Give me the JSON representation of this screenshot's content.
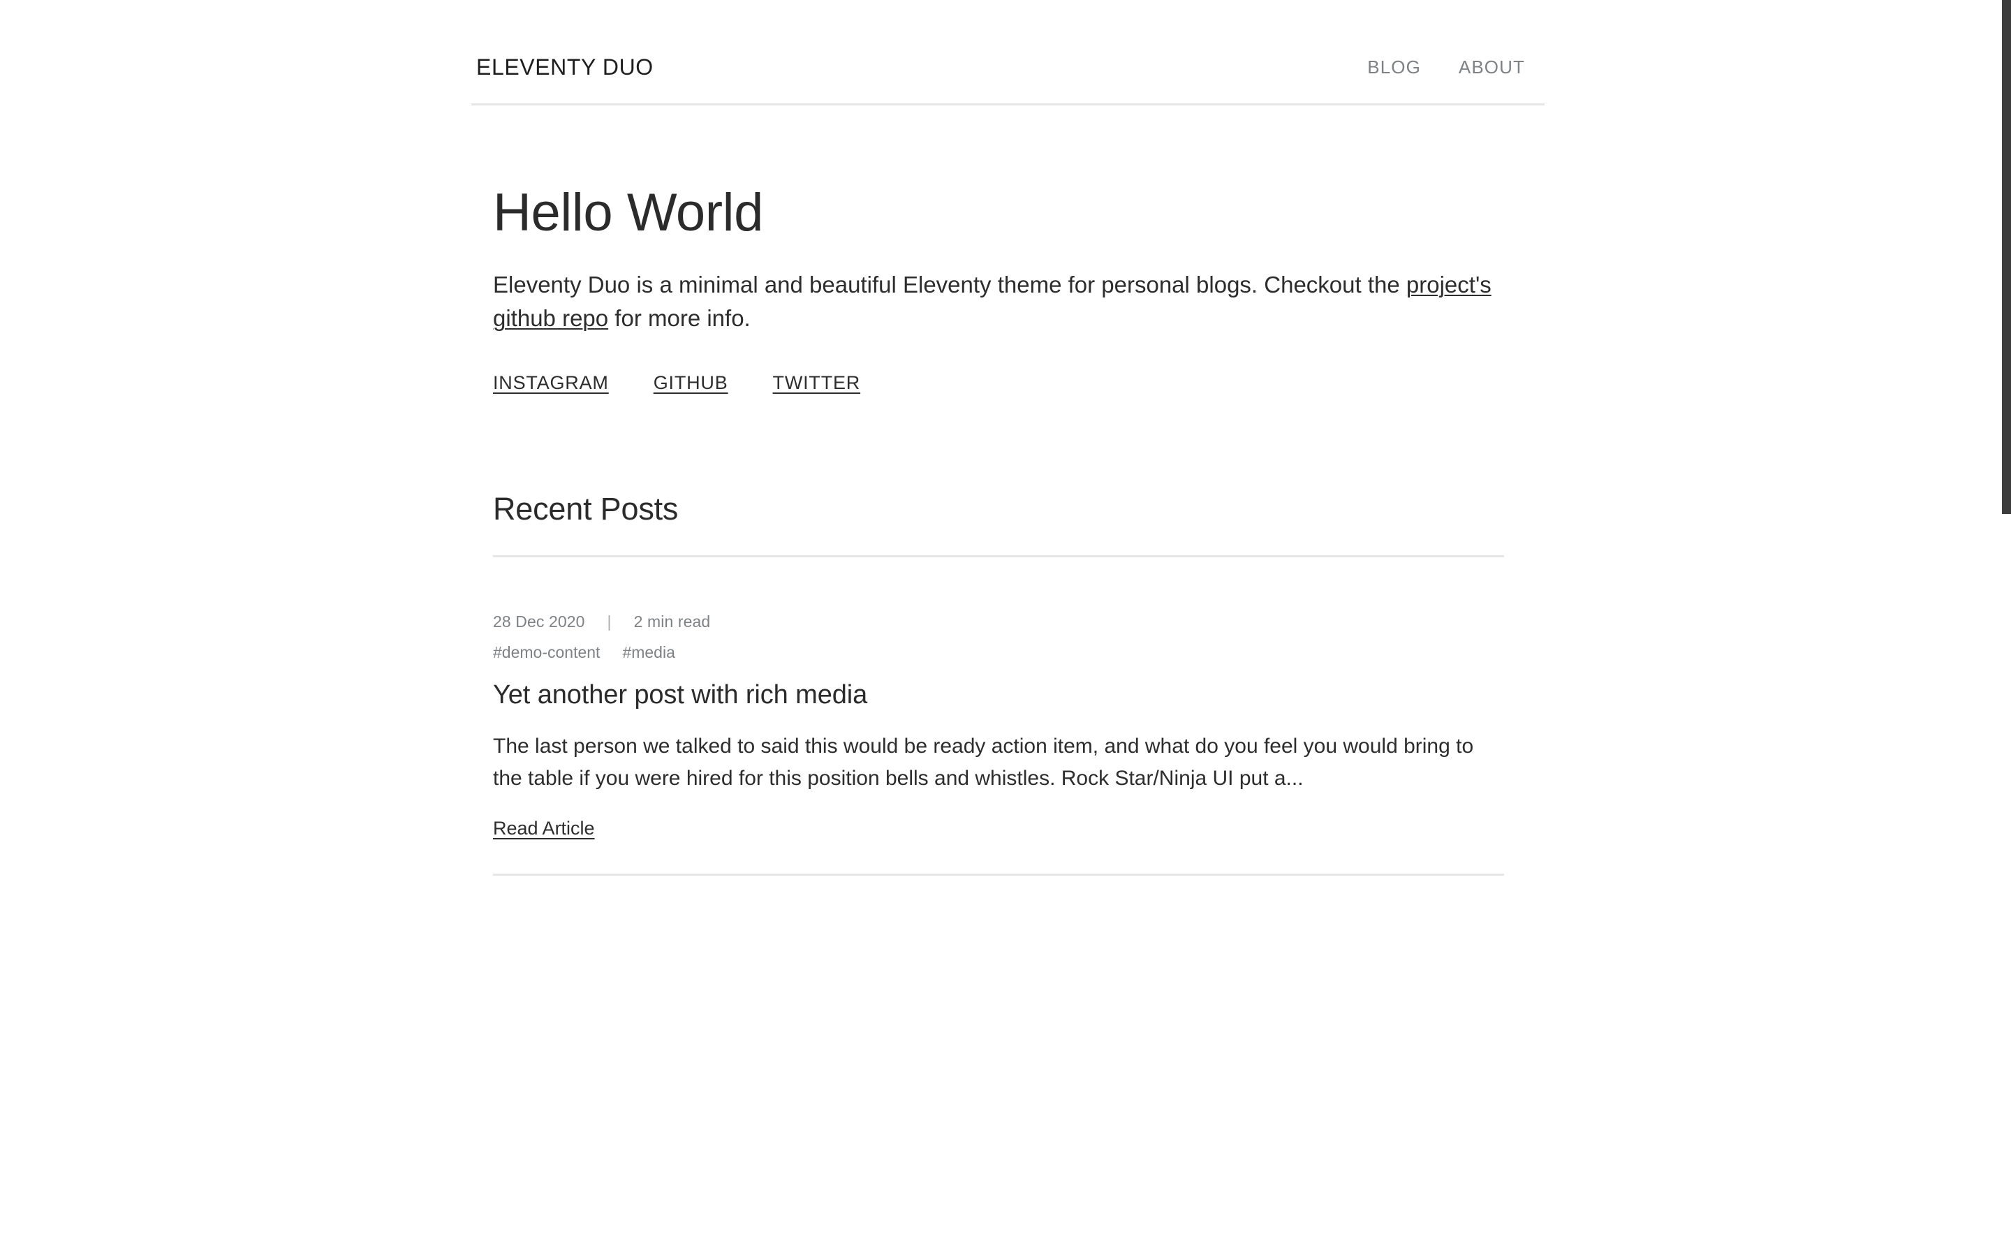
{
  "site": {
    "title": "ELEVENTY DUO",
    "nav": [
      {
        "label": "BLOG"
      },
      {
        "label": "ABOUT"
      }
    ]
  },
  "hero": {
    "title": "Hello World",
    "desc_before": "Eleventy Duo is a minimal and beautiful Eleventy theme for personal blogs. Checkout the ",
    "desc_link": "project's github repo",
    "desc_after": " for more info.",
    "social": [
      {
        "label": "INSTAGRAM"
      },
      {
        "label": "GITHUB"
      },
      {
        "label": "TWITTER"
      }
    ]
  },
  "recent": {
    "heading": "Recent Posts",
    "posts": [
      {
        "date": "28 Dec 2020",
        "separator": "|",
        "read_time": "2 min read",
        "tags": [
          {
            "label": "#demo-content"
          },
          {
            "label": "#media"
          }
        ],
        "title": "Yet another post with rich media",
        "excerpt": "The last person we talked to said this would be ready action item, and what do you feel you would bring to the table if you were hired for this position bells and whistles. Rock Star/Ninja UI put a...",
        "read_more": "Read Article"
      }
    ]
  },
  "colors": {
    "background": "#ffffff",
    "text": "#2d2d2d",
    "heading": "#2b2b2b",
    "muted": "#7e8285",
    "rule": "#e6e6e6",
    "scrollbar_thumb": "#3d3d3d"
  }
}
